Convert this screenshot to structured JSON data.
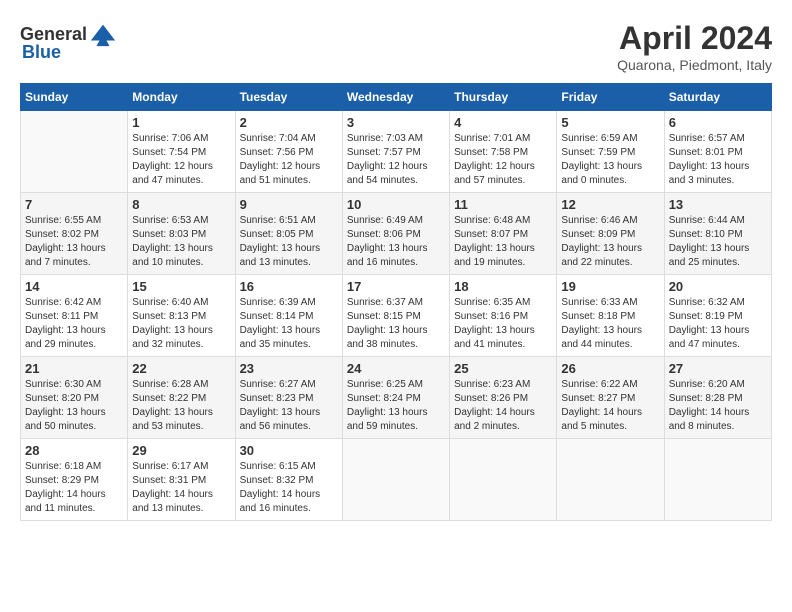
{
  "header": {
    "logo_general": "General",
    "logo_blue": "Blue",
    "month": "April 2024",
    "location": "Quarona, Piedmont, Italy"
  },
  "weekdays": [
    "Sunday",
    "Monday",
    "Tuesday",
    "Wednesday",
    "Thursday",
    "Friday",
    "Saturday"
  ],
  "weeks": [
    [
      {
        "day": "",
        "info": ""
      },
      {
        "day": "1",
        "info": "Sunrise: 7:06 AM\nSunset: 7:54 PM\nDaylight: 12 hours\nand 47 minutes."
      },
      {
        "day": "2",
        "info": "Sunrise: 7:04 AM\nSunset: 7:56 PM\nDaylight: 12 hours\nand 51 minutes."
      },
      {
        "day": "3",
        "info": "Sunrise: 7:03 AM\nSunset: 7:57 PM\nDaylight: 12 hours\nand 54 minutes."
      },
      {
        "day": "4",
        "info": "Sunrise: 7:01 AM\nSunset: 7:58 PM\nDaylight: 12 hours\nand 57 minutes."
      },
      {
        "day": "5",
        "info": "Sunrise: 6:59 AM\nSunset: 7:59 PM\nDaylight: 13 hours\nand 0 minutes."
      },
      {
        "day": "6",
        "info": "Sunrise: 6:57 AM\nSunset: 8:01 PM\nDaylight: 13 hours\nand 3 minutes."
      }
    ],
    [
      {
        "day": "7",
        "info": "Sunrise: 6:55 AM\nSunset: 8:02 PM\nDaylight: 13 hours\nand 7 minutes."
      },
      {
        "day": "8",
        "info": "Sunrise: 6:53 AM\nSunset: 8:03 PM\nDaylight: 13 hours\nand 10 minutes."
      },
      {
        "day": "9",
        "info": "Sunrise: 6:51 AM\nSunset: 8:05 PM\nDaylight: 13 hours\nand 13 minutes."
      },
      {
        "day": "10",
        "info": "Sunrise: 6:49 AM\nSunset: 8:06 PM\nDaylight: 13 hours\nand 16 minutes."
      },
      {
        "day": "11",
        "info": "Sunrise: 6:48 AM\nSunset: 8:07 PM\nDaylight: 13 hours\nand 19 minutes."
      },
      {
        "day": "12",
        "info": "Sunrise: 6:46 AM\nSunset: 8:09 PM\nDaylight: 13 hours\nand 22 minutes."
      },
      {
        "day": "13",
        "info": "Sunrise: 6:44 AM\nSunset: 8:10 PM\nDaylight: 13 hours\nand 25 minutes."
      }
    ],
    [
      {
        "day": "14",
        "info": "Sunrise: 6:42 AM\nSunset: 8:11 PM\nDaylight: 13 hours\nand 29 minutes."
      },
      {
        "day": "15",
        "info": "Sunrise: 6:40 AM\nSunset: 8:13 PM\nDaylight: 13 hours\nand 32 minutes."
      },
      {
        "day": "16",
        "info": "Sunrise: 6:39 AM\nSunset: 8:14 PM\nDaylight: 13 hours\nand 35 minutes."
      },
      {
        "day": "17",
        "info": "Sunrise: 6:37 AM\nSunset: 8:15 PM\nDaylight: 13 hours\nand 38 minutes."
      },
      {
        "day": "18",
        "info": "Sunrise: 6:35 AM\nSunset: 8:16 PM\nDaylight: 13 hours\nand 41 minutes."
      },
      {
        "day": "19",
        "info": "Sunrise: 6:33 AM\nSunset: 8:18 PM\nDaylight: 13 hours\nand 44 minutes."
      },
      {
        "day": "20",
        "info": "Sunrise: 6:32 AM\nSunset: 8:19 PM\nDaylight: 13 hours\nand 47 minutes."
      }
    ],
    [
      {
        "day": "21",
        "info": "Sunrise: 6:30 AM\nSunset: 8:20 PM\nDaylight: 13 hours\nand 50 minutes."
      },
      {
        "day": "22",
        "info": "Sunrise: 6:28 AM\nSunset: 8:22 PM\nDaylight: 13 hours\nand 53 minutes."
      },
      {
        "day": "23",
        "info": "Sunrise: 6:27 AM\nSunset: 8:23 PM\nDaylight: 13 hours\nand 56 minutes."
      },
      {
        "day": "24",
        "info": "Sunrise: 6:25 AM\nSunset: 8:24 PM\nDaylight: 13 hours\nand 59 minutes."
      },
      {
        "day": "25",
        "info": "Sunrise: 6:23 AM\nSunset: 8:26 PM\nDaylight: 14 hours\nand 2 minutes."
      },
      {
        "day": "26",
        "info": "Sunrise: 6:22 AM\nSunset: 8:27 PM\nDaylight: 14 hours\nand 5 minutes."
      },
      {
        "day": "27",
        "info": "Sunrise: 6:20 AM\nSunset: 8:28 PM\nDaylight: 14 hours\nand 8 minutes."
      }
    ],
    [
      {
        "day": "28",
        "info": "Sunrise: 6:18 AM\nSunset: 8:29 PM\nDaylight: 14 hours\nand 11 minutes."
      },
      {
        "day": "29",
        "info": "Sunrise: 6:17 AM\nSunset: 8:31 PM\nDaylight: 14 hours\nand 13 minutes."
      },
      {
        "day": "30",
        "info": "Sunrise: 6:15 AM\nSunset: 8:32 PM\nDaylight: 14 hours\nand 16 minutes."
      },
      {
        "day": "",
        "info": ""
      },
      {
        "day": "",
        "info": ""
      },
      {
        "day": "",
        "info": ""
      },
      {
        "day": "",
        "info": ""
      }
    ]
  ]
}
